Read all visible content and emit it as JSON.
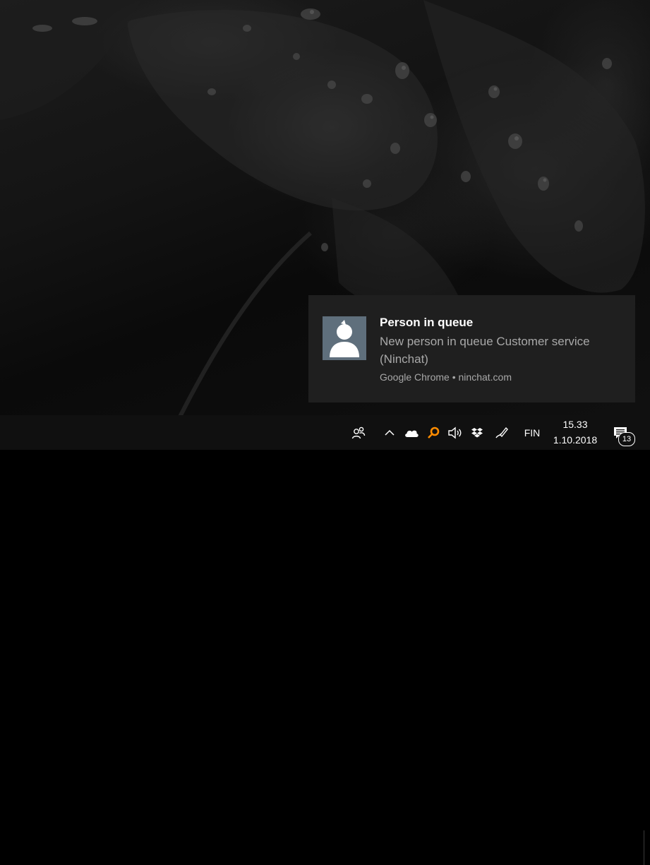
{
  "wallpaper": {
    "description_icon": "dark-leaf-wallpaper"
  },
  "notification": {
    "title": "Person in queue",
    "body": "New person in queue Customer service (Ninchat)",
    "source": "Google Chrome • ninchat.com",
    "avatar_icon": "person-icon",
    "background_color": "#1f1f1f",
    "avatar_color": "#5f6f7c"
  },
  "taskbar": {
    "tray_icons": [
      {
        "name": "people-icon"
      },
      {
        "name": "chevron-up-icon"
      },
      {
        "name": "onedrive-cloud-icon"
      },
      {
        "name": "search-app-icon"
      },
      {
        "name": "volume-icon"
      },
      {
        "name": "dropbox-icon"
      },
      {
        "name": "pen-workspace-icon"
      }
    ],
    "language": "FIN",
    "time": "15.33",
    "date": "1.10.2018",
    "notification_count": "13",
    "accent_orange": "#ff8c00"
  }
}
